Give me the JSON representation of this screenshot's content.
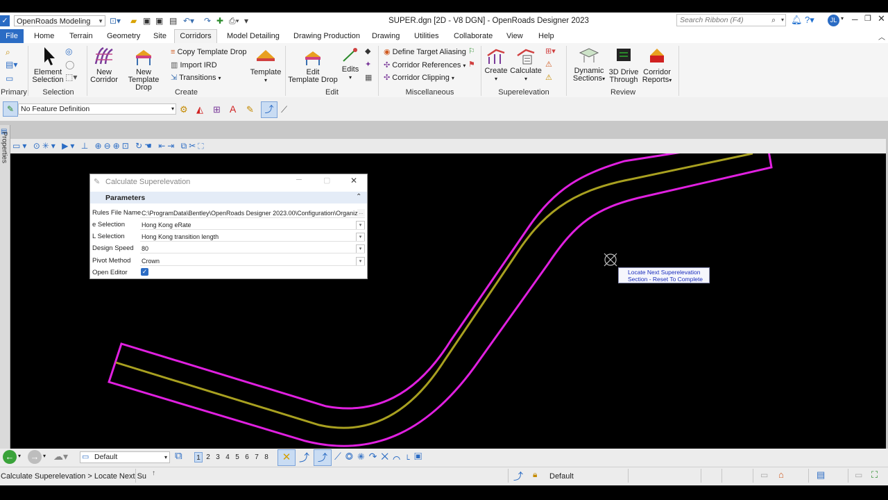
{
  "app": {
    "title": "SUPER.dgn [2D - V8 DGN] - OpenRoads Designer 2023",
    "workspace": "OpenRoads Modeling",
    "search_placeholder": "Search Ribbon (F4)",
    "user_initials": "JL"
  },
  "tabs": [
    "File",
    "Home",
    "Terrain",
    "Geometry",
    "Site",
    "Corridors",
    "Model Detailing",
    "Drawing Production",
    "Drawing",
    "Utilities",
    "Collaborate",
    "View",
    "Help"
  ],
  "ribbon": {
    "primary_label": "Primary",
    "selection": {
      "element_selection_1": "Element",
      "element_selection_2": "Selection",
      "label": "Selection"
    },
    "create": {
      "new_corridor_1": "New",
      "new_corridor_2": "Corridor",
      "new_template_drop_1": "New",
      "new_template_drop_2": "Template Drop",
      "copy_template_drop": "Copy Template Drop",
      "import_ird": "Import IRD",
      "transitions": "Transitions",
      "template": "Template",
      "label": "Create"
    },
    "edit": {
      "edit_template_drop_1": "Edit",
      "edit_template_drop_2": "Template Drop",
      "edits": "Edits",
      "label": "Edit"
    },
    "misc": {
      "define_target_aliasing": "Define Target Aliasing",
      "corridor_references": "Corridor References",
      "corridor_clipping": "Corridor Clipping",
      "label": "Miscellaneous"
    },
    "superelevation": {
      "create": "Create",
      "calculate": "Calculate",
      "label": "Superelevation"
    },
    "review": {
      "dynamic_sections_1": "Dynamic",
      "dynamic_sections_2": "Sections",
      "drive_through_1": "3D Drive",
      "drive_through_2": "Through",
      "corridor_reports_1": "Corridor",
      "corridor_reports_2": "Reports",
      "label": "Review"
    }
  },
  "feature_definition": "No Feature Definition",
  "properties_tab": "Properties",
  "dialog": {
    "title": "Calculate Superelevation",
    "section": "Parameters",
    "fields": [
      {
        "label": "Rules File Name",
        "value": "C:\\ProgramData\\Bentley\\OpenRoads Designer 2023.00\\Configuration\\Organiz"
      },
      {
        "label": "e Selection",
        "value": "Hong Kong eRate"
      },
      {
        "label": "L Selection",
        "value": "Hong Kong transition length"
      },
      {
        "label": "Design Speed",
        "value": "80"
      },
      {
        "label": "Pivot Method",
        "value": "Crown"
      }
    ],
    "open_editor_label": "Open Editor",
    "open_editor_checked": true
  },
  "tooltip": {
    "line1": "Locate Next Superelevation",
    "line2": "Section - Reset To Complete"
  },
  "level": "Default",
  "views": [
    "1",
    "2",
    "3",
    "4",
    "5",
    "6",
    "7",
    "8"
  ],
  "active_view": "1",
  "status": {
    "prompt": "Calculate Superelevation > Locate Next Su",
    "level": "Default"
  },
  "colors": {
    "accent": "#2b6cc4",
    "corridor_outline": "#e020e0",
    "centerline": "#a8a020",
    "canvas": "#000000"
  }
}
